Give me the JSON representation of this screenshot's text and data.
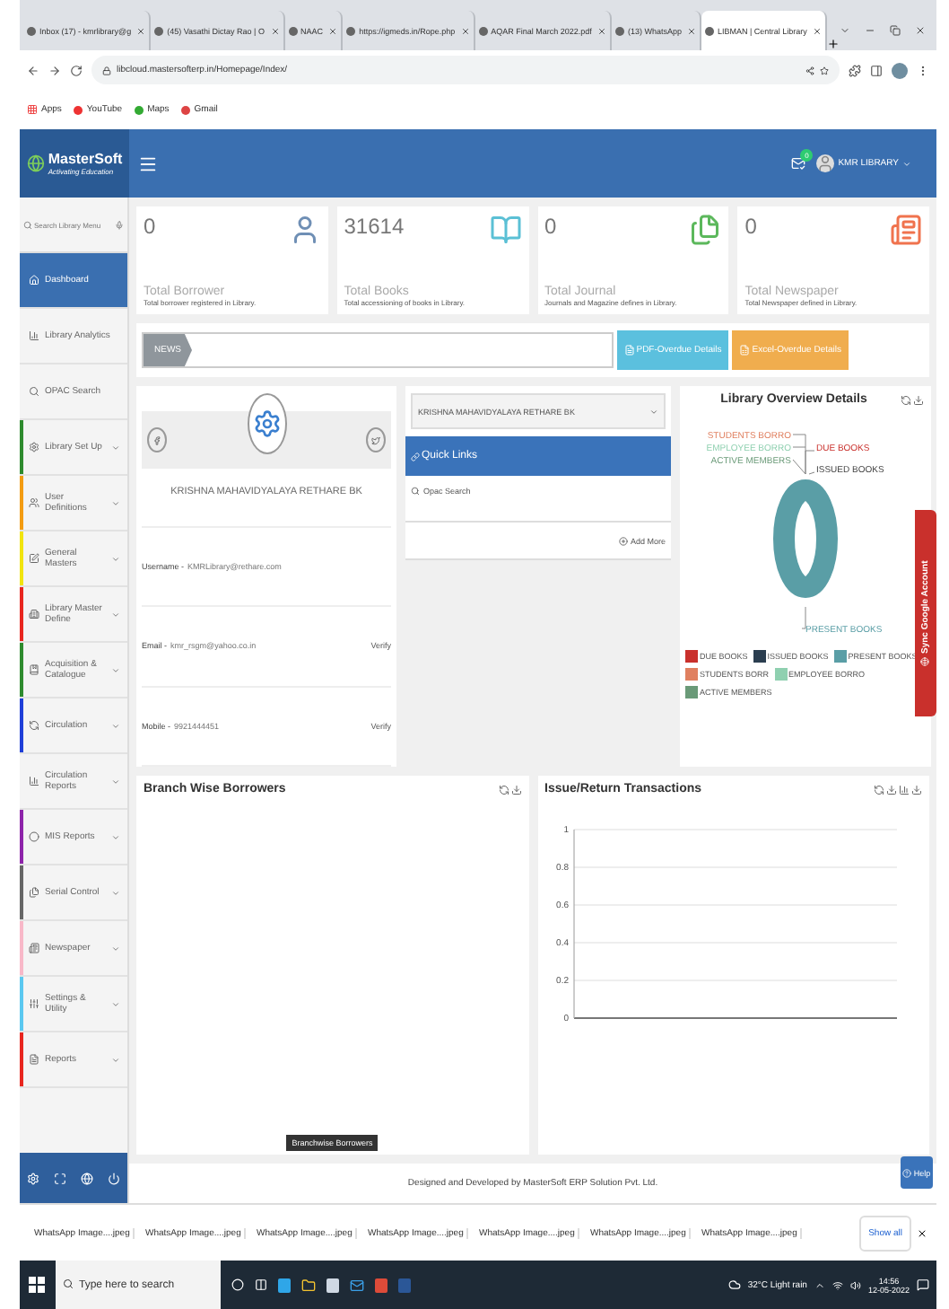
{
  "browser": {
    "tabs": [
      {
        "title": "Inbox (17) - kmrlibrary@g",
        "selected": false
      },
      {
        "title": "(45) Vasathi Dictay Rao | O",
        "selected": false
      },
      {
        "title": "NAAC",
        "selected": false
      },
      {
        "title": "https://igmeds.in/Rope.php",
        "selected": false
      },
      {
        "title": "AQAR Final March 2022.pdf",
        "selected": false
      },
      {
        "title": "(13) WhatsApp",
        "selected": false
      },
      {
        "title": "LIBMAN | Central Library",
        "selected": true
      }
    ],
    "url": "libcloud.mastersofterp.in/Homepage/Index/",
    "bookmarks": [
      "Apps",
      "YouTube",
      "Maps",
      "Gmail"
    ]
  },
  "app": {
    "logo": "MasterSoft",
    "tagline": "Activating Education",
    "notification_count": "0",
    "user": "KMR LIBRARY"
  },
  "sidebar": {
    "search_placeholder": "Search Library Menu",
    "items": [
      {
        "label": "Dashboard",
        "selected": true,
        "kind": "link"
      },
      {
        "label": "Library Analytics",
        "selected": false,
        "kind": "link"
      },
      {
        "label": "OPAC Search",
        "selected": false,
        "kind": "link"
      },
      {
        "label": "Library Set Up",
        "selected": false,
        "kind": "group",
        "color": "#2e8b2e"
      },
      {
        "label": "User Definitions",
        "selected": false,
        "kind": "group",
        "color": "#f39c12"
      },
      {
        "label": "General Masters",
        "selected": false,
        "kind": "group",
        "color": "#f1e40f"
      },
      {
        "label": "Library Master Define",
        "selected": false,
        "kind": "group",
        "color": "#e8261f"
      },
      {
        "label": "Acquisition & Catalogue",
        "selected": false,
        "kind": "group",
        "color": "#2e8b2e"
      },
      {
        "label": "Circulation",
        "selected": false,
        "kind": "group",
        "color": "#1f3fd8"
      },
      {
        "label": "Circulation Reports",
        "selected": false,
        "kind": "group"
      },
      {
        "label": "MIS Reports",
        "selected": false,
        "kind": "group",
        "color": "#8e24aa"
      },
      {
        "label": "Serial Control",
        "selected": false,
        "kind": "group",
        "color": "#666666"
      },
      {
        "label": "Newspaper",
        "selected": false,
        "kind": "group",
        "color": "#f8b8c8"
      },
      {
        "label": "Settings & Utility",
        "selected": false,
        "kind": "group",
        "color": "#5bc8f0"
      },
      {
        "label": "Reports",
        "selected": false,
        "kind": "group",
        "color": "#e8261f"
      }
    ]
  },
  "stats": [
    {
      "value": "0",
      "label": "Total Borrower",
      "note": "Total borrower registered in Library.",
      "kind": "person"
    },
    {
      "value": "31614",
      "label": "Total Books",
      "note": "Total accessioning of books in Library.",
      "kind": "book"
    },
    {
      "value": "0",
      "label": "Total Journal",
      "note": "Journals and Magazine defines in Library.",
      "kind": "journal"
    },
    {
      "value": "0",
      "label": "Total Newspaper",
      "note": "Total Newspaper defined in Library.",
      "kind": "newspaper"
    }
  ],
  "news": {
    "label": "NEWS",
    "buttons": [
      {
        "label": "PDF-Overdue Details",
        "kind": "pdf"
      },
      {
        "label": "Excel-Overdue Details",
        "kind": "excel"
      }
    ]
  },
  "profile": {
    "name": "KRISHNA MAHAVIDYALAYA RETHARE BK",
    "rows": [
      {
        "label": "Username -",
        "value": "KMRLibrary@rethare.com"
      },
      {
        "label": "Email -",
        "value": "kmr_rsgm@yahoo.co.in",
        "action": "Verify"
      },
      {
        "label": "Mobile -",
        "value": "9921444451",
        "action": "Verify"
      }
    ]
  },
  "quick": {
    "select_value": "KRISHNA MAHAVIDYALAYA RETHARE BK",
    "title": "Quick Links",
    "links": [
      "Opac Search"
    ],
    "add_more": "Add More"
  },
  "overview": {
    "title": "Library Overview Details",
    "callouts": [
      "STUDENTS BORRO",
      "EMPLOYEE BORRO",
      "ACTIVE MEMBERS",
      "DUE BOOKS",
      "ISSUED BOOKS",
      "PRESENT BOOKS"
    ],
    "legend": [
      {
        "label": "DUE BOOKS",
        "color": "#c9302c"
      },
      {
        "label": "ISSUED BOOKS",
        "color": "#2b3e50"
      },
      {
        "label": "PRESENT BOOKS",
        "color": "#5a9ea6"
      },
      {
        "label": "STUDENTS BORR",
        "color": "#e08060"
      },
      {
        "label": "EMPLOYEE BORRO",
        "color": "#8fd0b0"
      },
      {
        "label": "ACTIVE MEMBERS",
        "color": "#6a9a78"
      }
    ]
  },
  "branch": {
    "title": "Branch Wise Borrowers",
    "tooltip": "Branchwise Borrowers"
  },
  "issue": {
    "title": "Issue/Return Transactions",
    "y_axis_labels": [
      "1",
      "0.8",
      "0.6",
      "0.4",
      "0.2",
      "0"
    ]
  },
  "footer": "Designed and Developed by MasterSoft ERP Solution Pvt. Ltd.",
  "help": "Help",
  "sync": "Sync Google Account",
  "downloads": {
    "items": [
      "WhatsApp Image....jpeg",
      "WhatsApp Image....jpeg",
      "WhatsApp Image....jpeg",
      "WhatsApp Image....jpeg",
      "WhatsApp Image....jpeg",
      "WhatsApp Image....jpeg",
      "WhatsApp Image....jpeg"
    ],
    "show_all": "Show all"
  },
  "taskbar": {
    "search_placeholder": "Type here to search",
    "weather": "32°C Light rain",
    "time": "14:56",
    "date": "12-05-2022"
  }
}
